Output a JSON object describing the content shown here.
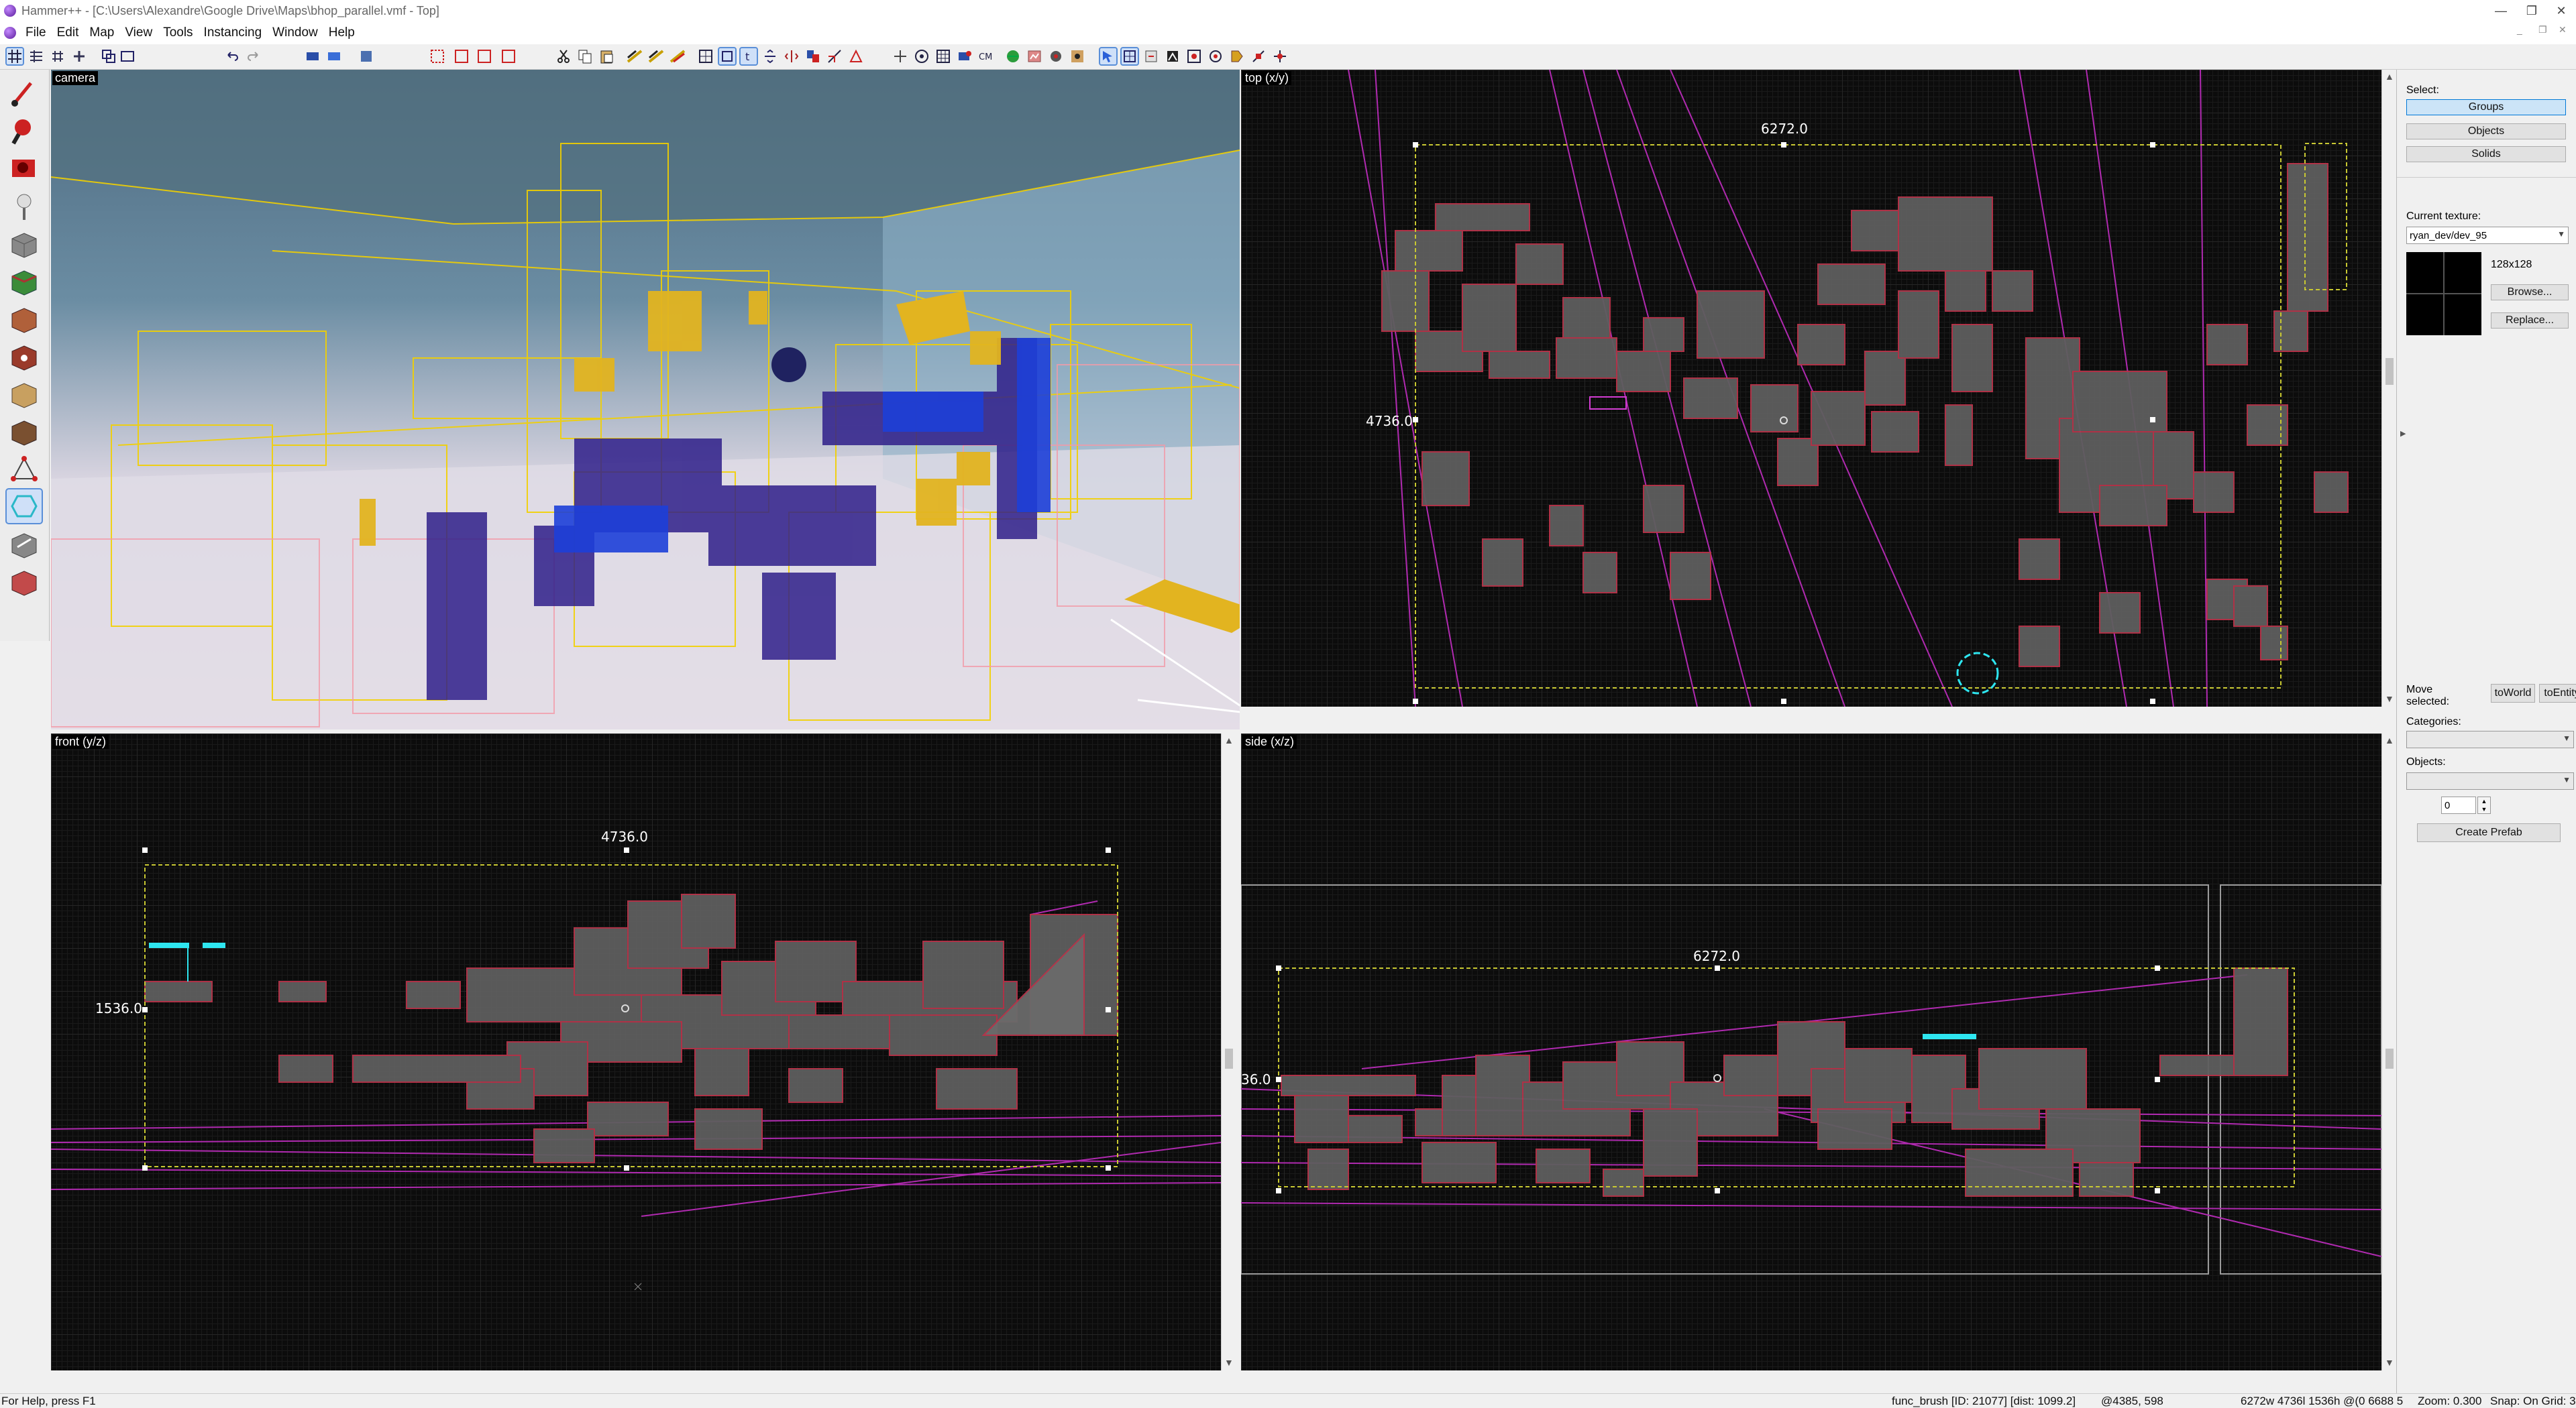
{
  "titlebar": {
    "title": "Hammer++ - [C:\\Users\\Alexandre\\Google Drive\\Maps\\bhop_parallel.vmf - Top]",
    "minimize": "—",
    "restore": "❐",
    "close": "✕"
  },
  "menu": {
    "items": [
      "File",
      "Edit",
      "Map",
      "View",
      "Tools",
      "Instancing",
      "Window",
      "Help"
    ],
    "mdi_controls": [
      "_",
      "❐",
      "✕"
    ]
  },
  "viewports": {
    "camera": {
      "label": "camera"
    },
    "top": {
      "label": "top (x/y)",
      "width_dim": "6272.0",
      "height_dim": "4736.0"
    },
    "front": {
      "label": "front (y/z)",
      "width_dim": "4736.0",
      "height_dim": "1536.0"
    },
    "side": {
      "label": "side (x/z)",
      "width_dim": "6272.0",
      "height_dim": "36.0"
    }
  },
  "panel": {
    "select_label": "Select:",
    "groups": "Groups",
    "objects": "Objects",
    "solids": "Solids",
    "current_texture_label": "Current texture:",
    "current_texture": "ryan_dev/dev_95",
    "texture_size": "128x128",
    "browse": "Browse...",
    "replace": "Replace...",
    "move_selected": "Move selected:",
    "to_world": "toWorld",
    "to_entity": "toEntity",
    "categories_label": "Categories:",
    "objects_label": "Objects:",
    "spinner_value": "0",
    "create_prefab": "Create Prefab"
  },
  "status": {
    "help": "For Help, press F1",
    "selection": "func_brush  [ID: 21077] [dist: 1099.2]",
    "coords": "@4385, 598",
    "size": "6272w 4736l 1536h @(0 6688 5",
    "zoom": "Zoom: 0.300",
    "snap": "Snap: On Grid: 3"
  },
  "colors": {
    "accent": "#0078d7",
    "brush_outline": "#c8384d",
    "brush_fill": "#6a6a6a",
    "entity_magenta": "#d23cd2",
    "selection_yellow": "#c8c832",
    "cyan_entity": "#2ee6f0"
  }
}
